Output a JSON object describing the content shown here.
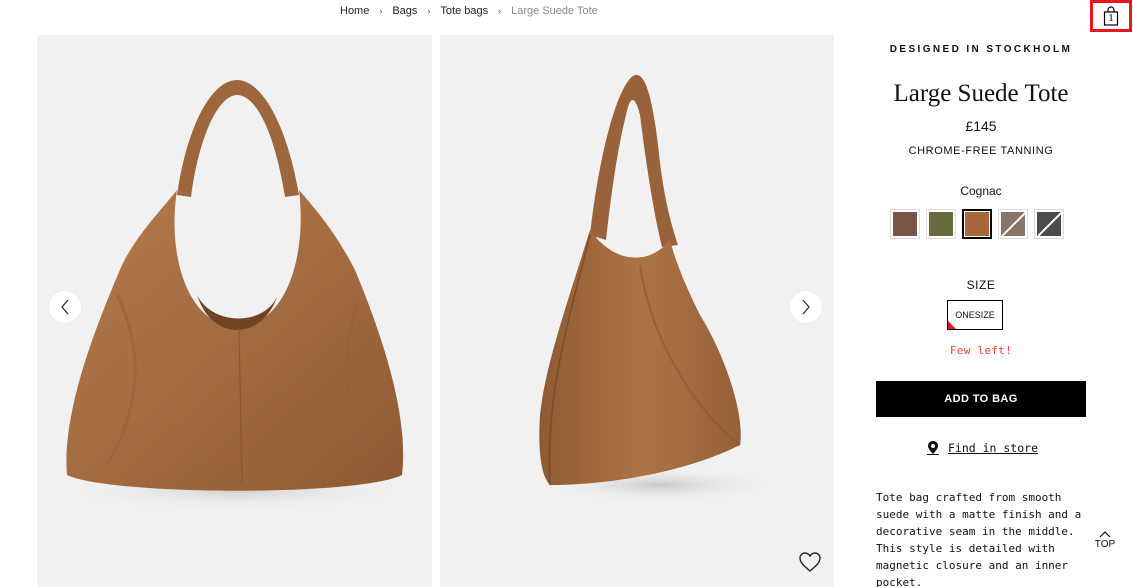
{
  "breadcrumb": {
    "items": [
      "Home",
      "Bags",
      "Tote bags"
    ],
    "current": "Large Suede Tote",
    "separator": "›"
  },
  "cart": {
    "count": "1",
    "icon": "shopping-bag-icon"
  },
  "product": {
    "tagline": "DESIGNED IN STOCKHOLM",
    "title": "Large Suede Tote",
    "price": "£145",
    "feature": "CHROME-FREE TANNING",
    "color_selected": "Cognac",
    "swatch_colors": [
      "#7a5447",
      "#6b6a3e",
      "#a8673a",
      "#8a7468",
      "#4f4b4d"
    ],
    "swatch_unavailable": [
      false,
      false,
      false,
      true,
      true
    ],
    "size_label": "SIZE",
    "size_option": "ONESIZE",
    "stock_note": "Few left!",
    "add_to_bag": "ADD TO BAG",
    "find_in_store": "Find in store",
    "description": "Tote bag crafted from smooth suede with a matte finish and a decorative seam in the middle. This style is detailed with magnetic closure and an inner pocket."
  },
  "nav": {
    "top_label": "TOP"
  },
  "colors": {
    "accent_red": "#e8161f",
    "stock_red": "#e8413b",
    "suede": "#a06a42"
  }
}
